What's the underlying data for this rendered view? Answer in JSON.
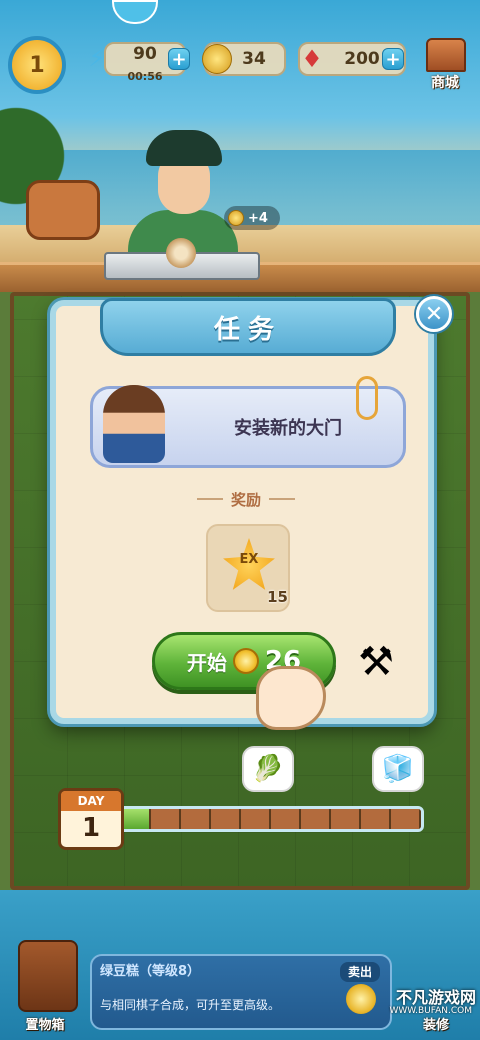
{
  "hud": {
    "level": "1",
    "energy": "90",
    "energy_timer": "00:56",
    "coins": "34",
    "gems": "200",
    "shop_label": "商城",
    "gold_popup": "+4"
  },
  "modal": {
    "title": "任务",
    "task_text": "安装新的大门",
    "reward_label": "奖励",
    "reward_badge": "EX",
    "reward_count": "15",
    "start_label": "开始",
    "start_cost": "26"
  },
  "day": {
    "label": "DAY",
    "number": "1",
    "progress_segments": 10,
    "progress_done": 1
  },
  "bottom": {
    "crate_label": "置物箱",
    "item_title": "绿豆糕（等级8）",
    "item_desc": "与相同棋子合成，可升至更高级。",
    "sell_label": "卖出",
    "decor_label": "装修"
  },
  "watermark": {
    "text": "不凡游戏网",
    "sub": "WWW.BUFAN.COM"
  },
  "colors": {
    "modal_border": "#a9d8e6",
    "modal_bg": "#f7ead3",
    "start_button": "#5fb43a",
    "title_bar": "#57acd4"
  },
  "icons": {
    "energy": "lightning-icon",
    "coin": "coin-icon",
    "gem": "gem-icon",
    "close": "close-icon",
    "tools": "crossed-tools-icon",
    "hand": "pointer-hand-icon"
  }
}
